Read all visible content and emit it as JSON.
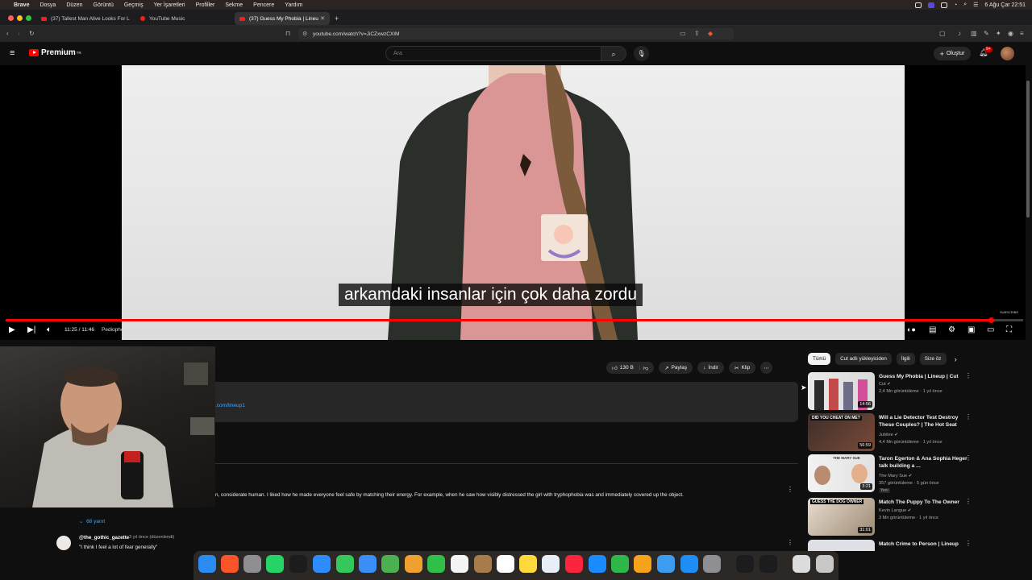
{
  "menubar": {
    "items": [
      "Brave",
      "Dosya",
      "Düzen",
      "Görüntü",
      "Geçmiş",
      "Yer İşaretleri",
      "Profiller",
      "Sekme",
      "Pencere",
      "Yardım"
    ],
    "clock": "6 Ağu Çar 22:51"
  },
  "tabs": [
    {
      "title": "(37) Tallest Man Alive Looks For L"
    },
    {
      "title": "YouTube Music"
    },
    {
      "title": "(37) Guess My Phobia | Lineu"
    }
  ],
  "address": {
    "url": "youtube.com/watch?v=JiCZxwzCXIM"
  },
  "youtube": {
    "logo_text": "Premium",
    "logo_region": "TR",
    "search_placeholder": "Ara",
    "create_label": "Oluştur",
    "notif_count": "9+"
  },
  "player": {
    "caption": "arkamdaki insanlar için çok daha zordu",
    "time": "11:25 / 11:46",
    "chapter": "Pediophobia- fear of dolls",
    "progress_fraction": 0.968,
    "subscribe_small": "SUBSCRIBE"
  },
  "actions": {
    "likes": "130 B",
    "share": "Paylaş",
    "download": "İndir",
    "clip": "Klip"
  },
  "description": {
    "link_fragment": ".com/lineup1"
  },
  "comments": {
    "first_text_fragment": "n, considerate human. I liked how he made everyone feel safe by matching their energy. For example, when he saw how visibly distressed the girl with tryphophobia was and immediately covered up the object.",
    "replies": "68 yanıt",
    "second_author": "@the_gothic_gazette",
    "second_meta": "3 yıl önce (düzenlendi)",
    "second_text": "\"I think I feel a lot of fear generally\""
  },
  "chips": [
    "Tümü",
    "Cut adlı yükleyiciden",
    "İlgili",
    "Size öz"
  ],
  "recommendations": [
    {
      "title": "Guess My Phobia | Lineup | Cut",
      "channel": "Cut",
      "meta": "2,4 Mn görüntüleme · 1 yıl önce",
      "duration": "14:56"
    },
    {
      "title": "Will a Lie Detector Test Destroy These Couples? | The Hot Seat",
      "channel": "Jubilee",
      "meta": "4,4 Mn görüntüleme · 1 yıl önce",
      "duration": "56:59",
      "thumb_text": "DID YOU CHEAT ON ME?"
    },
    {
      "title": "Taron Egerton & Ana Sophia Heger talk building a ...",
      "channel": "The Mary Sue",
      "meta": "357 görüntüleme · 5 gün önce",
      "duration": "3:21",
      "badge": "Yeni",
      "thumb_text": "THE MARY SUE"
    },
    {
      "title": "Match The Puppy To The Owner",
      "channel": "Kevin Langue",
      "meta": "3 Mn görüntüleme · 1 yıl önce",
      "duration": "31:01",
      "thumb_text": "GUESS THE DOG OWNER"
    },
    {
      "title": "Match Crime to Person | Lineup",
      "channel": "",
      "meta": "",
      "duration": ""
    }
  ],
  "icons": {
    "play": "play-icon",
    "next": "next-icon",
    "volume": "volume-icon",
    "settings": "gear-icon",
    "fullscreen": "fullscreen-icon",
    "search": "search-icon",
    "mic": "mic-icon",
    "bell": "bell-icon",
    "like": "thumbs-up-icon",
    "dislike": "thumbs-down-icon",
    "menu": "hamburger-icon"
  },
  "colors": {
    "accent": "#ff0000",
    "link": "#3ea6ff",
    "bg": "#0f0f0f"
  }
}
